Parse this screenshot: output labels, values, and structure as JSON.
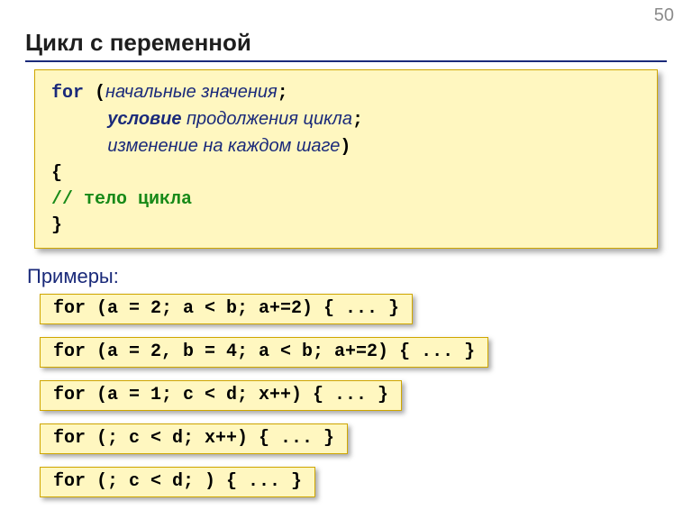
{
  "page_number": "50",
  "title": "Цикл с переменной",
  "syntax": {
    "for_kw": "for",
    "open_paren": "(",
    "init_text": "начальные значения",
    "semi1": ";",
    "cond_label": "условие",
    "cond_rest": " продолжения цикла",
    "semi2": ";",
    "step_text": "изменение на каждом шаге",
    "close_paren": ")",
    "open_brace": "{",
    "body_comment": "// тело цикла",
    "close_brace": "}"
  },
  "examples_label": "Примеры:",
  "examples": [
    "for (a = 2; a < b; a+=2) { ... }",
    "for (a = 2, b = 4; a < b; a+=2) { ... }",
    "for (a = 1; c < d; x++) { ... }",
    "for (; c < d; x++) { ... }",
    "for (; c < d; ) { ... }"
  ]
}
